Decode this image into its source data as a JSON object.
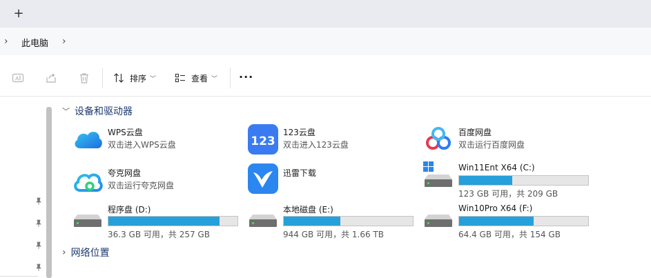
{
  "tabbar": {
    "newtab_symbol": "+"
  },
  "breadcrumb": {
    "prefix_chevron": "›",
    "location": "此电脑",
    "suffix_chevron": "›"
  },
  "toolbar": {
    "sort_label": "排序",
    "view_label": "查看",
    "more_label": "···",
    "icons": [
      "rename-icon",
      "share-icon",
      "delete-icon",
      "sort-icon",
      "view-icon"
    ]
  },
  "sections": {
    "devices": {
      "chevron": "﹀",
      "label": "设备和驱动器"
    },
    "network": {
      "chevron": "›",
      "label": "网络位置"
    }
  },
  "cloud": [
    {
      "name": "WPS云盘",
      "sub": "双击进入WPS云盘"
    },
    {
      "name": "123云盘",
      "sub": "双击进入123云盘"
    },
    {
      "name": "百度网盘",
      "sub": "双击运行百度网盘"
    },
    {
      "name": "夸克网盘",
      "sub": "双击运行夸克网盘"
    },
    {
      "name": "迅雷下载",
      "sub": ""
    }
  ],
  "drives": [
    {
      "name": "Win11Ent X64 (C:)",
      "caption": "123 GB 可用，共 209 GB",
      "used_fraction": 0.41
    },
    {
      "name": "程序盘 (D:)",
      "caption": "36.3 GB 可用，共 257 GB",
      "used_fraction": 0.86
    },
    {
      "name": "本地磁盘 (E:)",
      "caption": "944 GB 可用，共 1.66 TB",
      "used_fraction": 0.44
    },
    {
      "name": "Win10Pro X64 (F:)",
      "caption": "64.4 GB 可用，共 154 GB",
      "used_fraction": 0.58
    }
  ],
  "colors": {
    "accent": "#26a0da",
    "section_text": "#1e3a6e"
  }
}
